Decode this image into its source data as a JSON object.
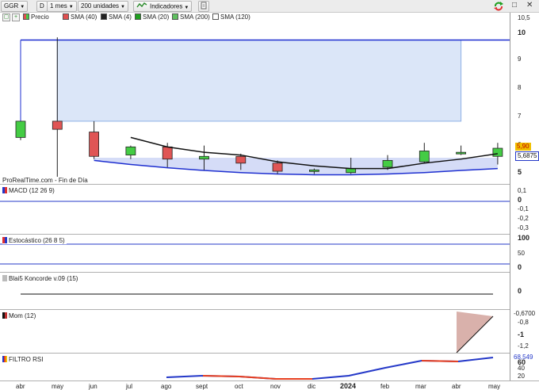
{
  "toolbar": {
    "ticker": "GGR",
    "period_code": "D",
    "timeframe": "1 mes",
    "units": "200 unidades",
    "indicators_label": "Indicadores",
    "window_buttons": [
      "↻",
      "□",
      "✕"
    ],
    "icons": [
      "refresh-icon",
      "restore-icon",
      "close-icon",
      "indicators-icon",
      "export-icon"
    ]
  },
  "legend": {
    "items": [
      "Precio",
      "SMA (40)",
      "SMA (4)",
      "SMA (20)",
      "SMA (200)",
      "SMA (120)"
    ],
    "colors": [
      "#e05050",
      "#222222",
      "#20a020",
      "#60c060",
      "#ffffff"
    ]
  },
  "price_panel": {
    "watermark": "ProRealTime.com - Fin de Día",
    "price_badge_1": "5,90",
    "price_badge_2": "5,6875",
    "accent_up": "#44cc44",
    "accent_down": "#e05555",
    "overlay_line": "#1e2fd0"
  },
  "panels": {
    "macd": "MACD (12 26 9)",
    "stochastic": "Estocástico (26 8 5)",
    "koncorde": "Blai5 Koncorde v.09 (15)",
    "mom": "Mom (12)",
    "rsi": "FILTRO RSI"
  },
  "axis": {
    "price": [
      "10,5",
      "10",
      "9",
      "8",
      "7",
      "6",
      "5"
    ],
    "price_bold": [
      "10",
      "5"
    ],
    "macd": [
      "0,1",
      "0",
      "-0,1",
      "-0,2",
      "-0,3"
    ],
    "macd_bold": [
      "0"
    ],
    "stoch": [
      "100",
      "50",
      "0"
    ],
    "stoch_bold": [
      "100",
      "0"
    ],
    "koncorde": [
      "0"
    ],
    "mom": [
      "-0,6700",
      "-0,8",
      "-1",
      "-1,2"
    ],
    "mom_bold": [
      "-1"
    ],
    "rsi": [
      "68,549",
      "60",
      "40",
      "20"
    ],
    "rsi_bold": [
      "60"
    ]
  },
  "x_axis": {
    "months": [
      "abr",
      "may",
      "jun",
      "jul",
      "ago",
      "sept",
      "oct",
      "nov",
      "dic",
      "2024",
      "feb",
      "mar",
      "abr",
      "may"
    ]
  },
  "chart_data": {
    "type": "candlestick",
    "categories": [
      "may",
      "jun",
      "jul",
      "ago",
      "sept",
      "oct",
      "nov",
      "dic",
      "2024",
      "feb",
      "mar",
      "abr",
      "may"
    ],
    "candles": [
      {
        "m": "abr",
        "o": 6.3,
        "h": 6.9,
        "l": 6.2,
        "c": 6.9
      },
      {
        "m": "may",
        "o": 6.9,
        "h": 10.0,
        "l": 4.8,
        "c": 6.6
      },
      {
        "m": "jun",
        "o": 6.5,
        "h": 6.9,
        "l": 5.5,
        "c": 5.6
      },
      {
        "m": "jul",
        "o": 5.65,
        "h": 6.0,
        "l": 5.5,
        "c": 5.95
      },
      {
        "m": "ago",
        "o": 5.95,
        "h": 6.1,
        "l": 5.2,
        "c": 5.5
      },
      {
        "m": "sept",
        "o": 5.5,
        "h": 6.0,
        "l": 5.1,
        "c": 5.6
      },
      {
        "m": "oct",
        "o": 5.6,
        "h": 5.7,
        "l": 5.1,
        "c": 5.35
      },
      {
        "m": "nov",
        "o": 5.35,
        "h": 5.45,
        "l": 4.95,
        "c": 5.05
      },
      {
        "m": "dic",
        "o": 5.05,
        "h": 5.15,
        "l": 4.95,
        "c": 5.1
      },
      {
        "m": "2024",
        "o": 5.0,
        "h": 5.55,
        "l": 4.95,
        "c": 5.15
      },
      {
        "m": "feb",
        "o": 5.2,
        "h": 5.65,
        "l": 5.1,
        "c": 5.45
      },
      {
        "m": "mar",
        "o": 5.4,
        "h": 6.1,
        "l": 5.35,
        "c": 5.8
      },
      {
        "m": "abr",
        "o": 5.75,
        "h": 6.0,
        "l": 5.65,
        "c": 5.75
      },
      {
        "m": "may",
        "o": 5.6,
        "h": 6.1,
        "l": 5.3,
        "c": 5.9
      }
    ],
    "sma4": [
      {
        "m": "jul",
        "y": 6.3
      },
      {
        "m": "ago",
        "y": 5.95
      },
      {
        "m": "sept",
        "y": 5.75
      },
      {
        "m": "oct",
        "y": 5.65
      },
      {
        "m": "nov",
        "y": 5.4
      },
      {
        "m": "dic",
        "y": 5.25
      },
      {
        "m": "2024",
        "y": 5.15
      },
      {
        "m": "feb",
        "y": 5.15
      },
      {
        "m": "mar",
        "y": 5.35
      },
      {
        "m": "abr",
        "y": 5.5
      },
      {
        "m": "may",
        "y": 5.7
      }
    ],
    "lower_band": [
      {
        "m": "jun",
        "y": 5.45
      },
      {
        "m": "jul",
        "y": 5.3
      },
      {
        "m": "ago",
        "y": 5.18
      },
      {
        "m": "sept",
        "y": 5.08
      },
      {
        "m": "oct",
        "y": 5.0
      },
      {
        "m": "nov",
        "y": 4.95
      },
      {
        "m": "dic",
        "y": 4.92
      },
      {
        "m": "2024",
        "y": 4.92
      },
      {
        "m": "feb",
        "y": 4.95
      },
      {
        "m": "mar",
        "y": 5.0
      },
      {
        "m": "abr",
        "y": 5.08
      },
      {
        "m": "may",
        "y": 5.15
      }
    ],
    "top_line_y": 9.9,
    "ylim": [
      4.7,
      10.5
    ]
  }
}
